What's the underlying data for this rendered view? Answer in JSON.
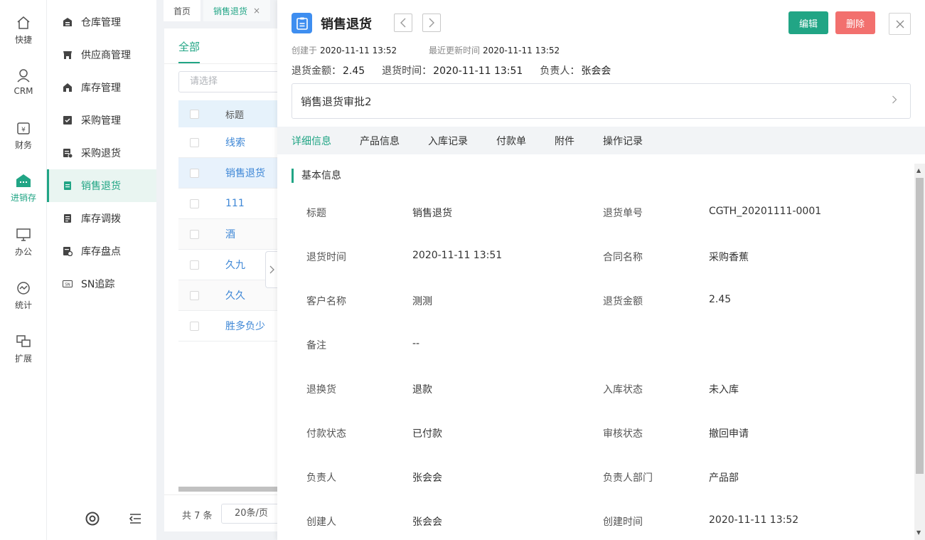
{
  "rail": [
    {
      "key": "quick",
      "label": "快捷",
      "icon": "home-icon"
    },
    {
      "key": "crm",
      "label": "CRM",
      "icon": "user-icon"
    },
    {
      "key": "finance",
      "label": "财务",
      "icon": "yen-wallet-icon"
    },
    {
      "key": "inventory",
      "label": "进销存",
      "icon": "store-icon",
      "active": true
    },
    {
      "key": "office",
      "label": "办公",
      "icon": "monitor-icon"
    },
    {
      "key": "stats",
      "label": "统计",
      "icon": "chart-circle-icon"
    },
    {
      "key": "ext",
      "label": "扩展",
      "icon": "extend-icon"
    }
  ],
  "subnav": [
    {
      "label": "仓库管理",
      "icon": "warehouse-icon"
    },
    {
      "label": "供应商管理",
      "icon": "supplier-icon"
    },
    {
      "label": "库存管理",
      "icon": "stock-icon"
    },
    {
      "label": "采购管理",
      "icon": "purchase-icon"
    },
    {
      "label": "采购退货",
      "icon": "purchase-return-icon"
    },
    {
      "label": "销售退货",
      "icon": "sales-return-icon",
      "active": true
    },
    {
      "label": "库存调拨",
      "icon": "transfer-icon"
    },
    {
      "label": "库存盘点",
      "icon": "stocktake-icon"
    },
    {
      "label": "SN追踪",
      "icon": "sn-icon"
    }
  ],
  "page_tabs": [
    {
      "label": "首页"
    },
    {
      "label": "销售退货",
      "close": "×",
      "active": true
    }
  ],
  "list": {
    "scope_tab": "全部",
    "filter_placeholder": "请选择",
    "column_title": "标题",
    "rows": [
      "线索",
      "销售退货",
      "111",
      "酒",
      "久九",
      "久久",
      "胜多负少"
    ],
    "total": "共 7 条",
    "page_size": "20条/页"
  },
  "detail": {
    "title": "销售退货",
    "edit_label": "编辑",
    "delete_label": "删除",
    "created_label": "创建于",
    "created_value": "2020-11-11 13:52",
    "updated_label": "最近更新时间",
    "updated_value": "2020-11-11 13:52",
    "summary": [
      {
        "label": "退货金额：",
        "value": "2.45"
      },
      {
        "label": "退货时间：",
        "value": "2020-11-11 13:51"
      },
      {
        "label": "负责人：",
        "value": "张会会"
      }
    ],
    "approval_name": "销售退货审批2",
    "tabs": [
      "详细信息",
      "产品信息",
      "入库记录",
      "付款单",
      "附件",
      "操作记录"
    ],
    "section_title": "基本信息",
    "fields": [
      {
        "label": "标题",
        "value": "销售退货"
      },
      {
        "label": "退货单号",
        "value": "CGTH_20201111-0001"
      },
      {
        "label": "退货时间",
        "value": "2020-11-11 13:51"
      },
      {
        "label": "合同名称",
        "value": "采购香蕉"
      },
      {
        "label": "客户名称",
        "value": "测测"
      },
      {
        "label": "退货金额",
        "value": "2.45"
      },
      {
        "label": "备注",
        "value": "--"
      },
      {
        "label": "退换货",
        "value": "退款"
      },
      {
        "label": "入库状态",
        "value": "未入库"
      },
      {
        "label": "付款状态",
        "value": "已付款"
      },
      {
        "label": "审核状态",
        "value": "撤回申请"
      },
      {
        "label": "负责人",
        "value": "张会会"
      },
      {
        "label": "负责人部门",
        "value": "产品部"
      },
      {
        "label": "创建人",
        "value": "张会会"
      },
      {
        "label": "创建时间",
        "value": "2020-11-11 13:52"
      }
    ]
  },
  "colors": {
    "accent": "#21a585",
    "danger": "#f2706e",
    "link": "#3e87d6",
    "badge": "#3e8ef0"
  }
}
